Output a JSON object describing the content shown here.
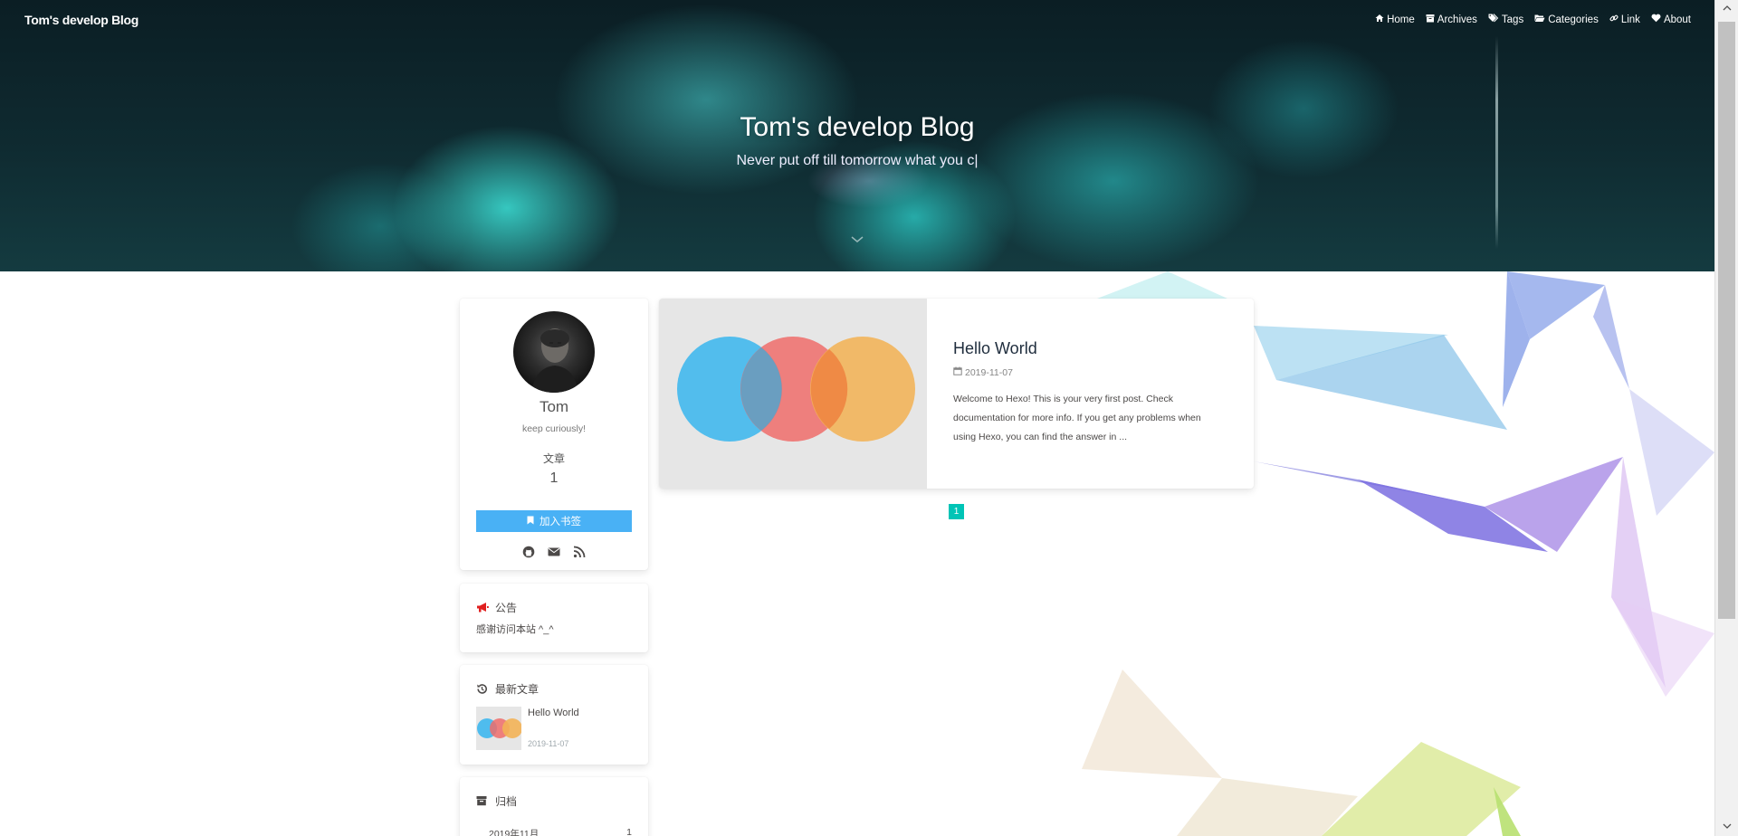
{
  "site": {
    "name": "Tom's develop Blog",
    "title": "Tom's develop Blog",
    "subtitle": "Never put off till tomorrow what you c|"
  },
  "nav": {
    "items": [
      {
        "label": "Home",
        "icon": "home-icon"
      },
      {
        "label": "Archives",
        "icon": "archive-icon"
      },
      {
        "label": "Tags",
        "icon": "tags-icon"
      },
      {
        "label": "Categories",
        "icon": "folder-icon"
      },
      {
        "label": "Link",
        "icon": "link-icon"
      },
      {
        "label": "About",
        "icon": "heart-icon"
      }
    ]
  },
  "profile": {
    "name": "Tom",
    "description": "keep curiously!",
    "stat_label": "文章",
    "stat_value": "1",
    "bookmark_label": "加入书签"
  },
  "announcement": {
    "title": "公告",
    "text": "感谢访问本站 ^_^"
  },
  "recent_posts": {
    "title": "最新文章",
    "items": [
      {
        "title": "Hello World",
        "date": "2019-11-07"
      }
    ]
  },
  "archives": {
    "title": "归档",
    "items": [
      {
        "label": "2019年11月",
        "count": "1"
      }
    ]
  },
  "posts": [
    {
      "title": "Hello World",
      "date": "2019-11-07",
      "excerpt": "Welcome to Hexo! This is your very first post. Check documentation for more info. If you get any problems when using Hexo, you can find the answer in ..."
    }
  ],
  "pagination": {
    "current": "1"
  },
  "colors": {
    "accent": "#49b1f5",
    "pagination": "#00c4b6",
    "announce_icon": "#e02020"
  }
}
